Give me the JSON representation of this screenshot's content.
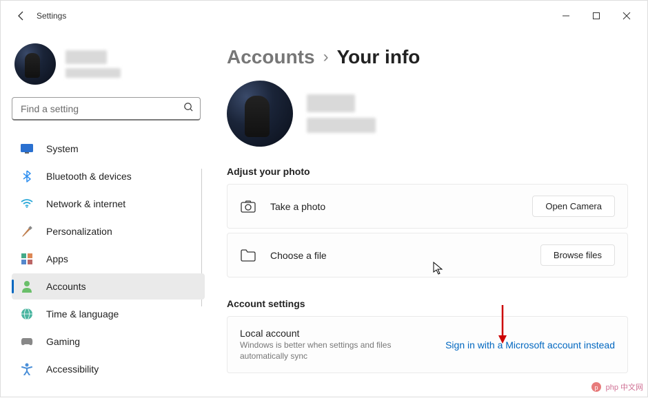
{
  "window": {
    "title": "Settings"
  },
  "profile": {
    "name_redacted": true
  },
  "search": {
    "placeholder": "Find a setting"
  },
  "sidebar": {
    "items": [
      {
        "icon": "monitor",
        "label": "System"
      },
      {
        "icon": "bluetooth",
        "label": "Bluetooth & devices"
      },
      {
        "icon": "wifi",
        "label": "Network & internet"
      },
      {
        "icon": "brush",
        "label": "Personalization"
      },
      {
        "icon": "apps",
        "label": "Apps"
      },
      {
        "icon": "person",
        "label": "Accounts"
      },
      {
        "icon": "globe",
        "label": "Time & language"
      },
      {
        "icon": "game",
        "label": "Gaming"
      },
      {
        "icon": "accessibility",
        "label": "Accessibility"
      }
    ],
    "active_index": 5
  },
  "breadcrumb": {
    "parent": "Accounts",
    "current": "Your info"
  },
  "photo_section": {
    "heading": "Adjust your photo",
    "take_photo_label": "Take a photo",
    "take_photo_button": "Open Camera",
    "choose_file_label": "Choose a file",
    "choose_file_button": "Browse files"
  },
  "account_section": {
    "heading": "Account settings",
    "local_title": "Local account",
    "local_desc": "Windows is better when settings and files automatically sync",
    "link_text": "Sign in with a Microsoft account instead"
  },
  "watermark": {
    "text": "php 中文网"
  }
}
